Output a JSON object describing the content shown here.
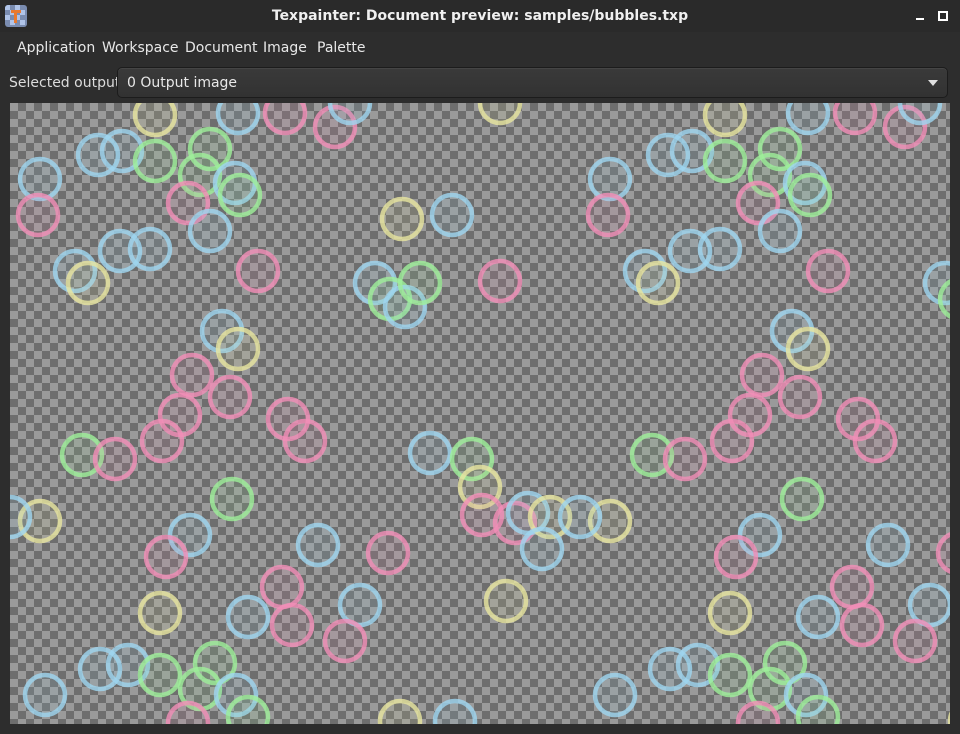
{
  "window": {
    "title": "Texpainter: Document preview: samples/bubbles.txp"
  },
  "menu": [
    "Application",
    "Workspace",
    "Document",
    "Image",
    "Palette"
  ],
  "toolbar": {
    "output_label": "Selected output:",
    "output_value": "0 Output image"
  },
  "colors": {
    "pink": "#f28fb8",
    "blue": "#9fd6f0",
    "green": "#9ff09a",
    "yellow": "#e8e6a0"
  },
  "icons": {
    "app": "texpainter-app-icon",
    "minimize": "minimize-icon",
    "maximize": "maximize-icon",
    "dropdown": "chevron-down-icon"
  }
}
